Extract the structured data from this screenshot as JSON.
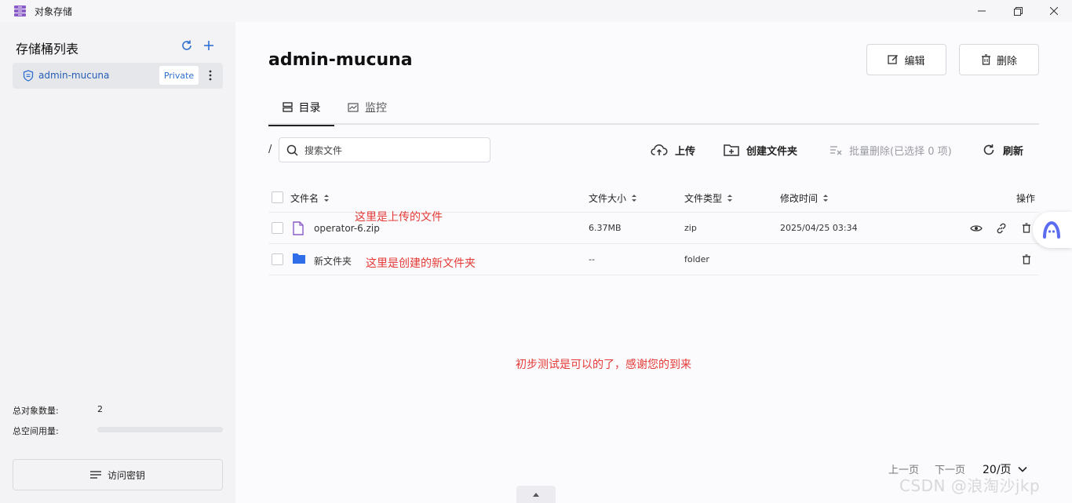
{
  "window": {
    "title": "对象存储"
  },
  "sidebar": {
    "title": "存储桶列表",
    "buckets": [
      {
        "name": "admin-mucuna",
        "visibility": "Private"
      }
    ],
    "stats": {
      "object_count_label": "总对象数量:",
      "object_count": "2",
      "space_used_label": "总空间用量:",
      "space_used_fraction": 0.0
    },
    "access_key_label": "访问密钥"
  },
  "main": {
    "title": "admin-mucuna",
    "edit_label": "编辑",
    "delete_label": "删除",
    "tabs": [
      {
        "label": "目录",
        "active": true
      },
      {
        "label": "监控",
        "active": false
      }
    ],
    "breadcrumb": "/",
    "search_placeholder": "搜索文件",
    "toolbar": {
      "upload": "上传",
      "new_folder": "创建文件夹",
      "batch_delete": "批量删除(已选择 0 项)",
      "refresh": "刷新"
    },
    "columns": {
      "name": "文件名",
      "size": "文件大小",
      "type": "文件类型",
      "modified": "修改时间",
      "actions": "操作"
    },
    "rows": [
      {
        "name": "operator-6.zip",
        "size": "6.37MB",
        "type": "zip",
        "modified": "2025/04/25 03:34",
        "icon": "file-zip-icon"
      },
      {
        "name": "新文件夹",
        "size": "--",
        "type": "folder",
        "modified": "",
        "icon": "folder-icon"
      }
    ],
    "annotations": {
      "uploaded": "这里是上传的文件",
      "created": "这里是创建的新文件夹",
      "thanks": "初步测试是可以的了，感谢您的到来"
    },
    "pagination": {
      "prev": "上一页",
      "next": "下一页",
      "page_size": "20/页"
    }
  },
  "watermark": "CSDN @浪淘沙jkp",
  "colors": {
    "accent": "#2f6fd0",
    "folder": "#2f6ee8",
    "annotation": "#e53935",
    "app_icon": "#8a5cc7"
  }
}
